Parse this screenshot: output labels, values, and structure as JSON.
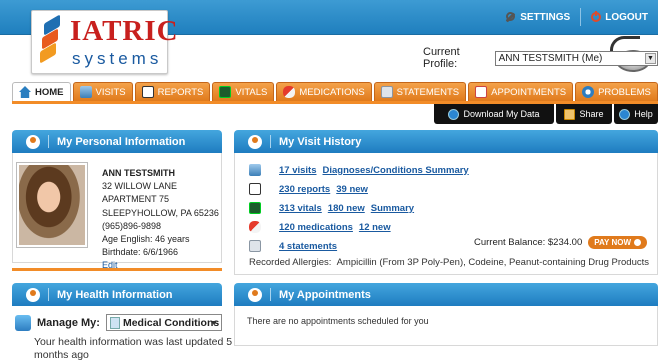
{
  "brand": {
    "word": "IATRIC",
    "sub": "systems"
  },
  "top_links": {
    "settings": "SETTINGS",
    "logout": "LOGOUT"
  },
  "profile": {
    "label": "Current Profile:",
    "value": "ANN TESTSMITH (Me)"
  },
  "tabs": [
    {
      "label": "HOME",
      "icon": "home-icon"
    },
    {
      "label": "VISITS",
      "icon": "visits-icon"
    },
    {
      "label": "REPORTS",
      "icon": "reports-icon"
    },
    {
      "label": "VITALS",
      "icon": "vitals-icon"
    },
    {
      "label": "MEDICATIONS",
      "icon": "medications-icon"
    },
    {
      "label": "STATEMENTS",
      "icon": "statements-icon"
    },
    {
      "label": "APPOINTMENTS",
      "icon": "appointments-icon"
    },
    {
      "label": "PROBLEMS",
      "icon": "problems-icon"
    }
  ],
  "actions": {
    "download": "Download My Data",
    "share": "Share",
    "help": "Help"
  },
  "personal": {
    "title": "My Personal Information",
    "name": "ANN TESTSMITH",
    "address1": "32 WILLOW LANE",
    "address2": "APARTMENT 75",
    "city": "SLEEPYHOLLOW, PA 65236",
    "phone": "(965)896-9898",
    "age": "Age English: 46 years",
    "birthdate": "Birthdate: 6/6/1966",
    "edit": "Edit"
  },
  "health": {
    "title": "My Health Information",
    "manage_label": "Manage My:",
    "manage_value": "Medical Conditions",
    "updated": "Your health information was last updated 5 months ago"
  },
  "visit_history": {
    "title": "My Visit History",
    "rows": [
      {
        "links": [
          "17 visits",
          "Diagnoses/Conditions Summary"
        ]
      },
      {
        "links": [
          "230 reports",
          "39 new"
        ]
      },
      {
        "links": [
          "313 vitals",
          "180 new",
          "Summary"
        ]
      },
      {
        "links": [
          "120 medications",
          "12 new"
        ]
      },
      {
        "links": [
          "4 statements"
        ]
      }
    ],
    "balance": "Current Balance: $234.00",
    "pay_now": "PAY NOW",
    "allergies_label": "Recorded Allergies:",
    "allergies_value": "Ampicillin (From 3P Poly-Pen), Codeine, Peanut-containing Drug Products"
  },
  "appointments": {
    "title": "My Appointments",
    "message": "There are no appointments scheduled for you"
  },
  "colors": {
    "accent_orange": "#e07a1c",
    "header_blue": "#1e7cc0",
    "brand_red": "#c8201e"
  }
}
